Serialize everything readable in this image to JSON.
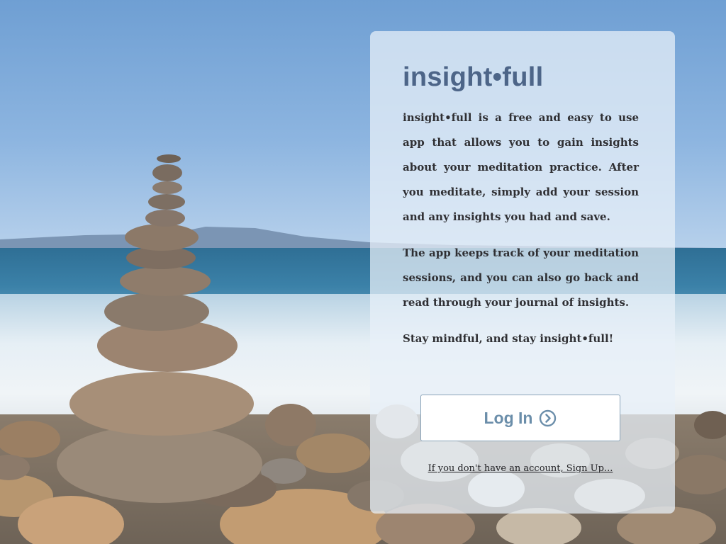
{
  "app": {
    "brand": "insight•full"
  },
  "intro": {
    "paragraph_1": "insight•full is a free and easy to use app that allows you to gain insights about your meditation practice. After you meditate, simply add your session and any insights you had and save.",
    "paragraph_2": "The app keeps track of your meditation sessions, and you can also go back and read through your journal of insights.",
    "paragraph_3": "Stay mindful, and stay insight•full!"
  },
  "actions": {
    "login_label": "Log In",
    "login_icon": "chevron-right-circle-icon",
    "signup_text": "If you don't have an account, Sign Up..."
  },
  "colors": {
    "brand": "#4d6588",
    "login_text": "#6b8eaa",
    "card_background": "#e8f0f8"
  }
}
